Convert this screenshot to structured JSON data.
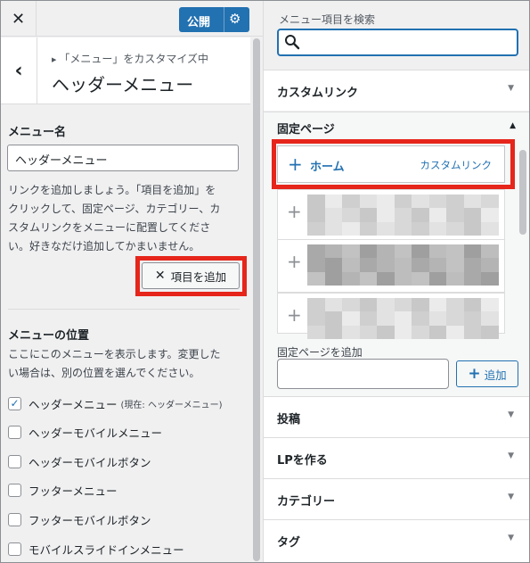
{
  "header": {
    "close_icon": "✕",
    "publish_label": "公開",
    "settings_icon": "⚙"
  },
  "panel": {
    "back_icon": "‹",
    "breadcrumb": "「メニュー」をカスタマイズ中",
    "title": "ヘッダーメニュー"
  },
  "menu_name": {
    "label": "メニュー名",
    "value": "ヘッダーメニュー"
  },
  "help_text": [
    "リンクを追加しましょう。「項目を追加」を",
    "クリックして、固定ページ、カテゴリー、カ",
    "スタムリンクをメニューに配置してくださ",
    "い。好きなだけ追加してかまいません。"
  ],
  "add_items_button": "項目を追加",
  "menu_location": {
    "title": "メニューの位置",
    "desc": [
      "ここにこのメニューを表示します。変更した",
      "い場合は、別の位置を選んでください。"
    ],
    "options": [
      {
        "label": "ヘッダーメニュー",
        "note": "(現在: ヘッダーメニュー)",
        "checked": true
      },
      {
        "label": "ヘッダーモバイルメニュー",
        "note": "",
        "checked": false
      },
      {
        "label": "ヘッダーモバイルボタン",
        "note": "",
        "checked": false
      },
      {
        "label": "フッターメニュー",
        "note": "",
        "checked": false
      },
      {
        "label": "フッターモバイルボタン",
        "note": "",
        "checked": false
      },
      {
        "label": "モバイルスライドインメニュー",
        "note": "",
        "checked": false
      }
    ]
  },
  "search": {
    "label": "メニュー項目を検索",
    "placeholder": ""
  },
  "sections": {
    "custom_link": "カスタムリンク",
    "pages": "固定ページ",
    "posts": "投稿",
    "lp": "LPを作る",
    "categories": "カテゴリー",
    "tags": "タグ"
  },
  "pages_list": {
    "home": {
      "name": "ホーム",
      "type": "カスタムリンク"
    },
    "add_label": "固定ページを追加",
    "add_button": "追加"
  },
  "colors": {
    "accent": "#2271b1",
    "highlight": "#e6251b",
    "panel_bg": "#f0f0f1"
  }
}
